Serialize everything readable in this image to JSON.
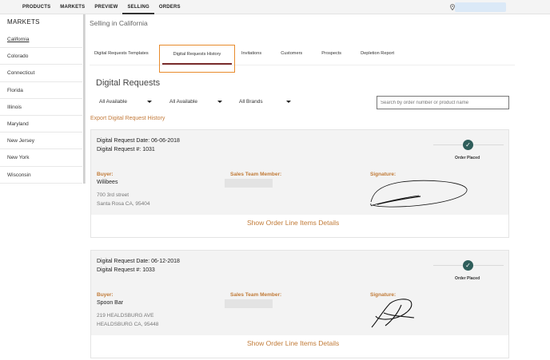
{
  "topnav": {
    "items": [
      {
        "label": "PRODUCTS"
      },
      {
        "label": "MARKETS"
      },
      {
        "label": "PREVIEW"
      },
      {
        "label": "SELLING"
      },
      {
        "label": "ORDERS"
      }
    ],
    "active": "SELLING",
    "location_icon": "map-pin-icon"
  },
  "sidebar": {
    "title": "MARKETS",
    "items": [
      {
        "label": "California"
      },
      {
        "label": "Colorado"
      },
      {
        "label": "Connecticut"
      },
      {
        "label": "Florida"
      },
      {
        "label": "Illinois"
      },
      {
        "label": "Maryland"
      },
      {
        "label": "New Jersey"
      },
      {
        "label": "New York"
      },
      {
        "label": "Wisconsin"
      }
    ],
    "active": "California"
  },
  "page": {
    "subtitle": "Selling in California"
  },
  "tabs": [
    {
      "label": "Digital Requests Templates"
    },
    {
      "label": "Digital Requests History"
    },
    {
      "label": "Invitations"
    },
    {
      "label": "Customers"
    },
    {
      "label": "Prospects"
    },
    {
      "label": "Depletion Report"
    }
  ],
  "active_tab": "Digital Requests History",
  "main": {
    "title": "Digital Requests",
    "filters": [
      {
        "value": "All Available"
      },
      {
        "value": "All Available"
      },
      {
        "value": "All Brands"
      }
    ],
    "search_placeholder": "Search by order number or product name",
    "export_link": "Export Digital Request History"
  },
  "requests": [
    {
      "date_line": "Digital Request Date: 06-06-2018",
      "number_line": "Digital Request #: 1031",
      "status": "Order Placed",
      "buyer_label": "Buyer:",
      "buyer": "Wilibees",
      "address_line1": "700 3rd street",
      "address_line2": "Santa Rosa CA, 95404",
      "sales_team_label": "Sales Team Member:",
      "signature_label": "Signature:",
      "details_link": "Show Order Line Items Details"
    },
    {
      "date_line": "Digital Request Date: 06-12-2018",
      "number_line": "Digital Request #: 1033",
      "status": "Order Placed",
      "buyer_label": "Buyer:",
      "buyer": "Spoon Bar",
      "address_line1": "219 HEALDSBURG AVE",
      "address_line2": "HEALDSBURG CA, 95448",
      "sales_team_label": "Sales Team Member:",
      "signature_label": "Signature:",
      "details_link": "Show Order Line Items Details"
    }
  ],
  "colors": {
    "accent": "#c17b38",
    "tab_highlight": "#e88b2c",
    "status_check": "#2f5e5b"
  }
}
